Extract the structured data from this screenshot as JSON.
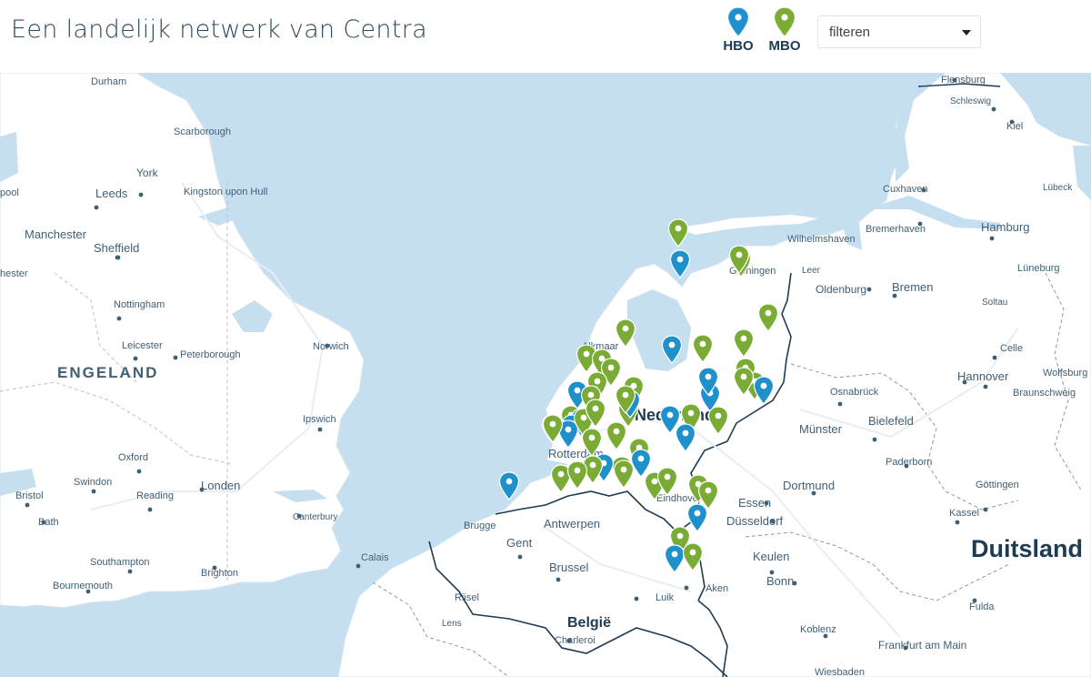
{
  "header": {
    "title": "Een landelijk netwerk van Centra",
    "legend": [
      {
        "label": "HBO",
        "color": "#1e90cc",
        "icon": "map-pin-icon"
      },
      {
        "label": "MBO",
        "color": "#7aab34",
        "icon": "map-pin-icon"
      }
    ],
    "filter": {
      "label": "filteren",
      "icon": "caret-down-icon"
    }
  },
  "map": {
    "colors": {
      "water": "#c6dff0",
      "land": "#ffffff",
      "hbo": "#1e90cc",
      "mbo": "#7aab34",
      "border": "#1d3b52"
    },
    "countries": {
      "uk": "ENGELAND",
      "nl": "Nederland",
      "be": "België",
      "de": "Duitsland"
    },
    "cities": {
      "durham": "Durham",
      "scarborough": "Scarborough",
      "york": "York",
      "leeds": "Leeds",
      "kingston": "Kingston upon Hull",
      "manchester": "Manchester",
      "sheffield": "Sheffield",
      "pool": "pool",
      "hester": "hester",
      "nottingham": "Nottingham",
      "leicester": "Leicester",
      "peterborough": "Peterborough",
      "norwich": "Norwich",
      "ipswich": "Ipswich",
      "oxford": "Oxford",
      "swindon": "Swindon",
      "reading": "Reading",
      "london": "Londen",
      "bristol": "Bristol",
      "bath": "Bath",
      "canterbury": "Canterbury",
      "southampton": "Southampton",
      "bournemouth": "Bournemouth",
      "brighton": "Brighton",
      "calais": "Calais",
      "brugge": "Brugge",
      "antwerpen": "Antwerpen",
      "gent": "Gent",
      "brussel": "Brussel",
      "luik": "Luik",
      "charleroi": "Charleroi",
      "rijsel": "Rijsel",
      "lens": "Lens",
      "aken": "Aken",
      "alkmaar": "Alkmaar",
      "rotterdam": "Rotterdam",
      "eindhoven": "Eindhoven",
      "groningen": "Groningen",
      "flensburg": "Flensburg",
      "schleswig": "Schleswig",
      "kiel": "Kiel",
      "lubeck": "Lübeck",
      "cuxhaven": "Cuxhaven",
      "hamburg": "Hamburg",
      "bremerhaven": "Bremerhaven",
      "wilhelmshaven": "Wilhelmshaven",
      "leer": "Leer",
      "oldenburg": "Oldenburg",
      "bremen": "Bremen",
      "luneburg": "Lüneburg",
      "soltau": "Soltau",
      "celle": "Celle",
      "hannover": "Hannover",
      "wolfsburg": "Wolfsburg",
      "braunschweig": "Braunschweig",
      "osnabruck": "Osnabrück",
      "bielefeld": "Bielefeld",
      "munster": "Münster",
      "paderborn": "Paderborn",
      "gottingen": "Göttingen",
      "dortmund": "Dortmund",
      "essen": "Essen",
      "kassel": "Kassel",
      "dusseldorf": "Düsseldorf",
      "keulen": "Keulen",
      "bonn": "Bonn",
      "fulda": "Fulda",
      "koblenz": "Koblenz",
      "frankfurt": "Frankfurt am Main",
      "wiesbaden": "Wiesbaden"
    },
    "markers": [
      {
        "type": "mbo"
      },
      {
        "type": "hbo"
      },
      {
        "type": "mbo"
      },
      {
        "type": "mbo"
      },
      {
        "type": "mbo"
      },
      {
        "type": "hbo"
      },
      {
        "type": "mbo"
      },
      {
        "type": "mbo"
      },
      {
        "type": "mbo"
      },
      {
        "type": "mbo"
      },
      {
        "type": "mbo"
      },
      {
        "type": "mbo"
      },
      {
        "type": "mbo"
      },
      {
        "type": "mbo"
      },
      {
        "type": "hbo"
      },
      {
        "type": "mbo"
      },
      {
        "type": "mbo"
      },
      {
        "type": "hbo"
      },
      {
        "type": "hbo"
      },
      {
        "type": "mbo"
      },
      {
        "type": "hbo"
      },
      {
        "type": "mbo"
      },
      {
        "type": "mbo"
      },
      {
        "type": "mbo"
      },
      {
        "type": "hbo"
      },
      {
        "type": "mbo"
      },
      {
        "type": "hbo"
      },
      {
        "type": "mbo"
      },
      {
        "type": "hbo"
      },
      {
        "type": "mbo"
      },
      {
        "type": "hbo"
      },
      {
        "type": "mbo"
      },
      {
        "type": "mbo"
      },
      {
        "type": "mbo"
      },
      {
        "type": "hbo"
      },
      {
        "type": "hbo"
      },
      {
        "type": "mbo"
      },
      {
        "type": "mbo"
      },
      {
        "type": "mbo"
      },
      {
        "type": "mbo"
      },
      {
        "type": "hbo"
      },
      {
        "type": "mbo"
      },
      {
        "type": "mbo"
      },
      {
        "type": "hbo"
      },
      {
        "type": "mbo"
      },
      {
        "type": "mbo"
      },
      {
        "type": "mbo"
      },
      {
        "type": "mbo"
      },
      {
        "type": "mbo"
      },
      {
        "type": "mbo"
      },
      {
        "type": "mbo"
      },
      {
        "type": "hbo"
      },
      {
        "type": "mbo"
      },
      {
        "type": "hbo"
      },
      {
        "type": "mbo"
      },
      {
        "type": "hbo"
      }
    ]
  }
}
